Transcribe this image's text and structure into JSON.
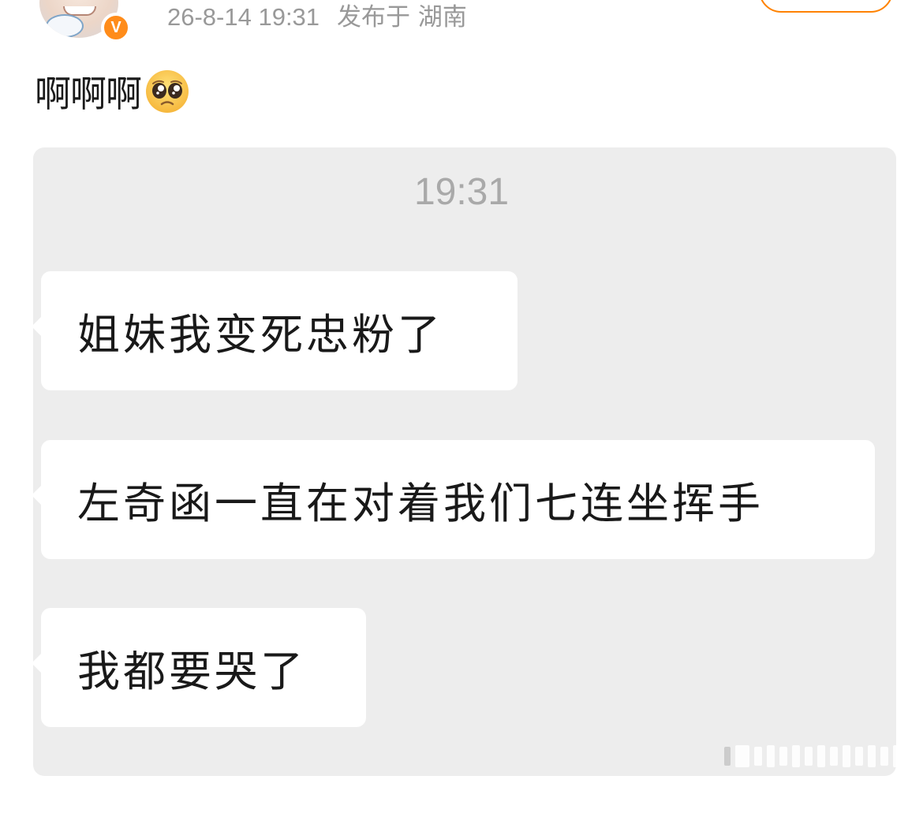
{
  "header": {
    "timestamp": "26-8-14 19:31",
    "location": "发布于 湖南",
    "verified_glyph": "V",
    "verified_color": "#ff8c1a",
    "follow_border_color": "#ff8200"
  },
  "post": {
    "text": "啊啊啊",
    "emoji_icon": "pleading-face-emoji"
  },
  "chat": {
    "time": "19:31",
    "messages": [
      {
        "text": "姐妹我变死忠粉了"
      },
      {
        "text": "左奇函一直在对着我们七连坐挥手"
      },
      {
        "text": "我都要哭了"
      }
    ]
  }
}
